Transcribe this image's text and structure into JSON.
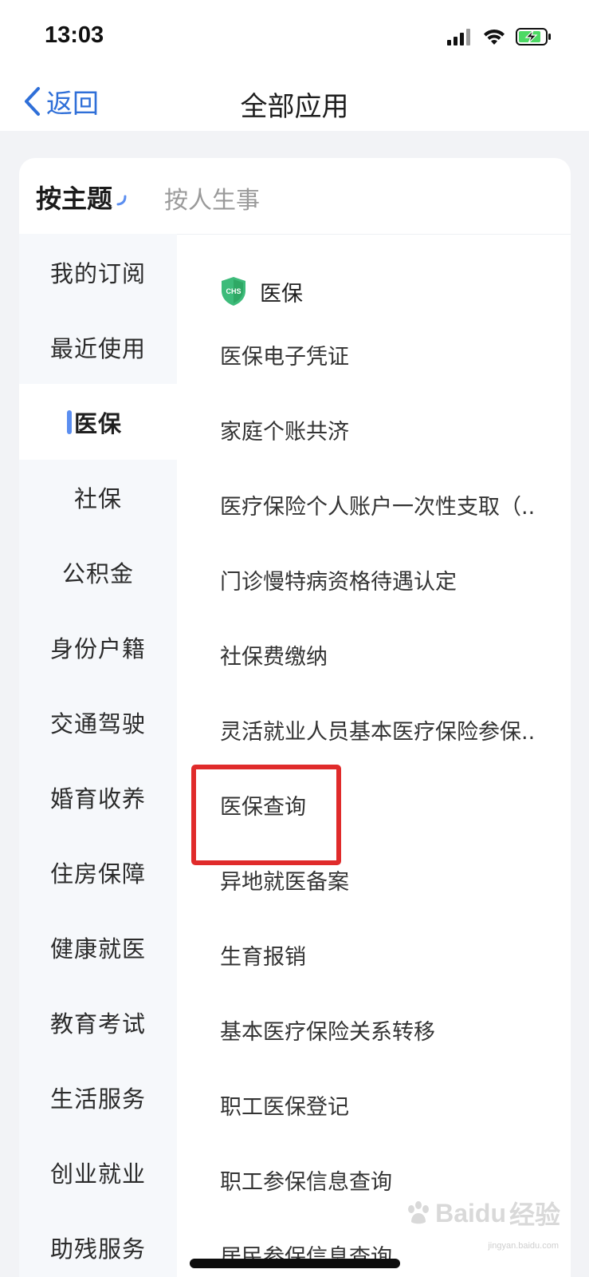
{
  "status_bar": {
    "time": "13:03"
  },
  "nav": {
    "back_label": "返回",
    "title": "全部应用"
  },
  "tabs": [
    {
      "label": "按主题"
    },
    {
      "label": "按人生事"
    }
  ],
  "sidebar": {
    "items": [
      {
        "label": "我的订阅"
      },
      {
        "label": "最近使用"
      },
      {
        "label": "医保"
      },
      {
        "label": "社保"
      },
      {
        "label": "公积金"
      },
      {
        "label": "身份户籍"
      },
      {
        "label": "交通驾驶"
      },
      {
        "label": "婚育收养"
      },
      {
        "label": "住房保障"
      },
      {
        "label": "健康就医"
      },
      {
        "label": "教育考试"
      },
      {
        "label": "生活服务"
      },
      {
        "label": "创业就业"
      },
      {
        "label": "助残服务"
      }
    ]
  },
  "content": {
    "section_title": "医保",
    "section_icon": "chs-shield-icon",
    "section_icon_text": "CHS",
    "items": [
      {
        "label": "医保电子凭证"
      },
      {
        "label": "家庭个账共济"
      },
      {
        "label": "医疗保险个人账户一次性支取（.."
      },
      {
        "label": "门诊慢特病资格待遇认定"
      },
      {
        "label": "社保费缴纳"
      },
      {
        "label": "灵活就业人员基本医疗保险参保.."
      },
      {
        "label": "医保查询"
      },
      {
        "label": "异地就医备案"
      },
      {
        "label": "生育报销"
      },
      {
        "label": "基本医疗保险关系转移"
      },
      {
        "label": "职工医保登记"
      },
      {
        "label": "职工参保信息查询"
      },
      {
        "label": "居民参保信息查询"
      }
    ]
  },
  "watermark": {
    "brand": "Baidu",
    "brand_cn": "经验",
    "url": "jingyan.baidu.com"
  },
  "colors": {
    "accent": "#2f6fd8",
    "active_bar": "#5b8ef0",
    "highlight": "#e02b2b",
    "shield": "#3dbb7a"
  }
}
